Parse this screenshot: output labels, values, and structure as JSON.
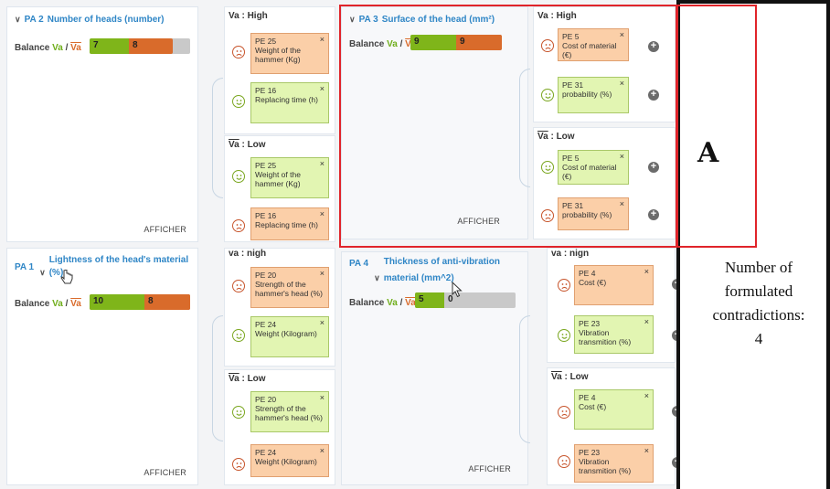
{
  "colors": {
    "green": "#7fb51a",
    "orange": "#d96b2b",
    "title_blue": "#2f86c6",
    "red_box": "#e0242a"
  },
  "balance_label": {
    "prefix": "Balance ",
    "va": "Va",
    "sep": " / ",
    "vabar": "Va"
  },
  "afficher": "AFFICHER",
  "plus_symbol": "+",
  "close_symbol": "×",
  "chevron": "∨",
  "params": [
    {
      "code": "PA 2",
      "title": "Number of heads (number)",
      "bal_green": "7",
      "bal_orange": "8",
      "green_fraction": 0.39,
      "orange_fraction": 0.44
    },
    {
      "code": "PA 1",
      "title": "Lightness of the head's material (%)",
      "bal_green": "10",
      "bal_orange": "8",
      "green_fraction": 0.55,
      "orange_fraction": 0.45
    },
    {
      "code": "PA 3",
      "title": "Surface of the head (mm²)",
      "bal_green": "9",
      "bal_orange": "9",
      "green_fraction": 0.5,
      "orange_fraction": 0.5
    },
    {
      "code": "PA 4",
      "title": "Thickness of anti-vibration material (mm^2)",
      "bal_green": "5",
      "bal_orange": "0",
      "green_fraction": 0.3,
      "orange_fraction": 0.0
    }
  ],
  "groups": {
    "high": "Va : High",
    "low_prefix": "Va",
    "low_suffix": " : Low",
    "high_cut": "va : nigh",
    "high_cut2": "va : nign"
  },
  "pe": {
    "pa2_high_1": {
      "code": "PE 25",
      "label": "Weight of the hammer (Kg)"
    },
    "pa2_high_2": {
      "code": "PE 16",
      "label": "Replacing time (h)"
    },
    "pa2_low_1": {
      "code": "PE 25",
      "label": "Weight of the hammer (Kg)"
    },
    "pa2_low_2": {
      "code": "PE 16",
      "label": "Replacing time (h)"
    },
    "pa1_high_1": {
      "code": "PE 20",
      "label": "Strength of the hammer's head (%)"
    },
    "pa1_high_2": {
      "code": "PE 24",
      "label": "Weight (Kilogram)"
    },
    "pa1_low_1": {
      "code": "PE 20",
      "label": "Strength of the hammer's head (%)"
    },
    "pa1_low_2": {
      "code": "PE 24",
      "label": "Weight (Kilogram)"
    },
    "pa3_high_1": {
      "code": "PE 5",
      "label": "Cost of material (€)"
    },
    "pa3_high_2": {
      "code": "PE 31",
      "label": "probability (%)"
    },
    "pa3_low_1": {
      "code": "PE 5",
      "label": "Cost of material (€)"
    },
    "pa3_low_2": {
      "code": "PE 31",
      "label": "probability (%)"
    },
    "pa4_high_1": {
      "code": "PE 4",
      "label": "Cost (€)"
    },
    "pa4_high_2": {
      "code": "PE 23",
      "label": "Vibration transmition (%)"
    },
    "pa4_low_1": {
      "code": "PE 4",
      "label": "Cost (€)"
    },
    "pa4_low_2": {
      "code": "PE 23",
      "label": "Vibration transmition (%)"
    }
  },
  "annotation": {
    "letter": "A",
    "line1": "Number of",
    "line2": "formulated",
    "line3": "contradictions:",
    "line4": "4"
  }
}
